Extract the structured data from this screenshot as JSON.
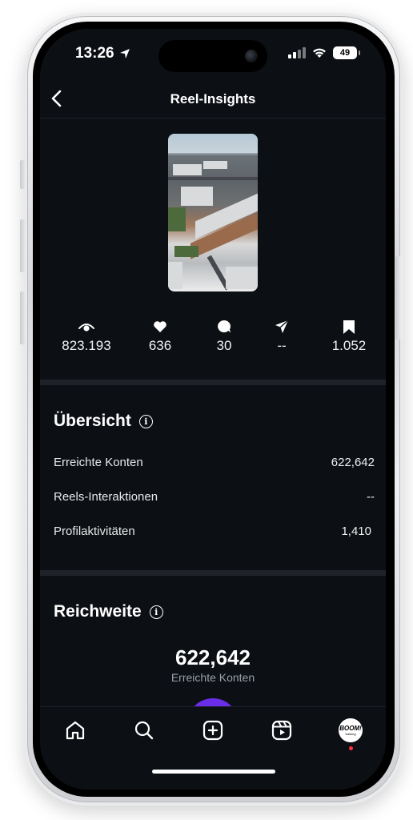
{
  "status_bar": {
    "time": "13:26",
    "battery": "49"
  },
  "header": {
    "title": "Reel-Insights"
  },
  "stats": [
    {
      "icon": "eye-icon",
      "value": "823.193"
    },
    {
      "icon": "heart-icon",
      "value": "636"
    },
    {
      "icon": "comment-icon",
      "value": "30"
    },
    {
      "icon": "send-icon",
      "value": "--"
    },
    {
      "icon": "bookmark-icon",
      "value": "1.052"
    }
  ],
  "overview": {
    "title": "Übersicht",
    "rows": [
      {
        "label": "Erreichte Konten",
        "value": "622,642"
      },
      {
        "label": "Reels-Interaktionen",
        "value": "--"
      },
      {
        "label": "Profilaktivitäten",
        "value": "1,410"
      }
    ]
  },
  "reach": {
    "title": "Reichweite",
    "number": "622,642",
    "label": "Erreichte Konten"
  },
  "profile_avatar": {
    "brand": "BOOM!",
    "sub": "training"
  },
  "colors": {
    "background": "#0c0f14",
    "divider": "#1f2329",
    "accent_purple": "#6a2ee8",
    "notification": "#ff3040"
  }
}
